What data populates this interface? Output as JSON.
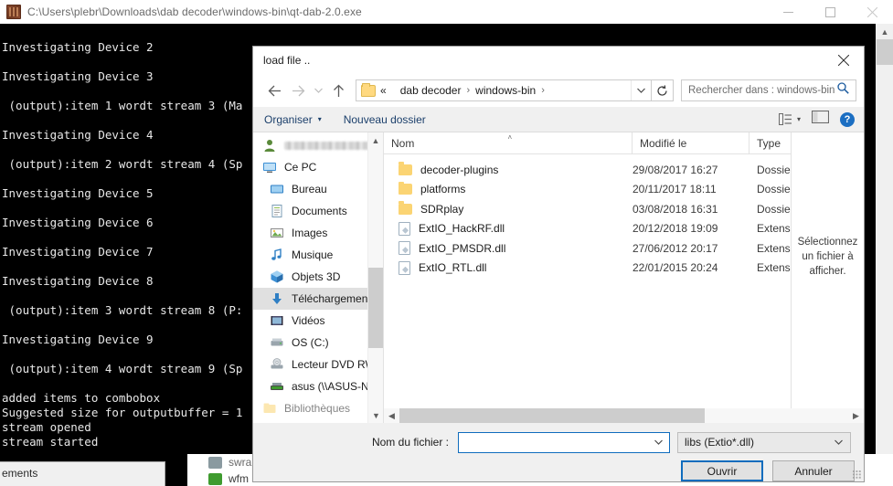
{
  "console_window": {
    "title": "C:\\Users\\plebr\\Downloads\\dab decoder\\windows-bin\\qt-dab-2.0.exe",
    "app_icon": "app-icon",
    "controls": {
      "minimize": "minimize-icon",
      "maximize": "maximize-icon",
      "close": "close-icon"
    },
    "lines": [
      "Investigating Device 2",
      "Investigating Device 3",
      " (output):item 1 wordt stream 3 (Ma",
      "Investigating Device 4",
      " (output):item 2 wordt stream 4 (Sp",
      "Investigating Device 5",
      "Investigating Device 6",
      "Investigating Device 7",
      "Investigating Device 8",
      " (output):item 3 wordt stream 8 (P:",
      "Investigating Device 9",
      " (output):item 4 wordt stream 9 (Sp"
    ],
    "tail_lines": [
      "added items to combobox",
      "Suggested size for outputbuffer = 1",
      "stream opened",
      "stream started"
    ]
  },
  "background": {
    "left_window_label": "ements",
    "items": [
      {
        "label": "swra",
        "color": "#8a9aa0"
      },
      {
        "label": "wfm",
        "color": "#3f9b2f"
      }
    ]
  },
  "dialog": {
    "title": "load file ..",
    "close_icon": "close-icon",
    "nav": {
      "back_icon": "arrow-left-icon",
      "forward_icon": "arrow-right-icon",
      "history_icon": "chevron-down-icon",
      "up_icon": "arrow-up-icon",
      "folder_icon": "folder-icon",
      "breadcrumb_prefix": "«",
      "breadcrumbs": [
        "dab decoder",
        "windows-bin"
      ],
      "breadcrumb_sep": "›",
      "dropdown_icon": "chevron-down-icon",
      "refresh_icon": "refresh-icon"
    },
    "search": {
      "placeholder": "Rechercher dans : windows-bin",
      "icon": "search-icon"
    },
    "toolbar": {
      "organize_label": "Organiser",
      "organize_caret": "▾",
      "new_folder_label": "Nouveau dossier",
      "view_icon": "view-list-icon",
      "view_caret": "▾",
      "preview_pane_icon": "preview-pane-icon",
      "help_icon": "help-icon",
      "help_glyph": "?"
    },
    "sidebar": {
      "items": [
        {
          "label": "",
          "icon": "user-icon",
          "blurred": true,
          "selected": false,
          "level": 0
        },
        {
          "label": "Ce PC",
          "icon": "computer-icon",
          "selected": false,
          "level": 0
        },
        {
          "label": "Bureau",
          "icon": "desktop-icon",
          "selected": false,
          "level": 1
        },
        {
          "label": "Documents",
          "icon": "documents-icon",
          "selected": false,
          "level": 1
        },
        {
          "label": "Images",
          "icon": "pictures-icon",
          "selected": false,
          "level": 1
        },
        {
          "label": "Musique",
          "icon": "music-icon",
          "selected": false,
          "level": 1
        },
        {
          "label": "Objets 3D",
          "icon": "3d-objects-icon",
          "selected": false,
          "level": 1
        },
        {
          "label": "Téléchargemen",
          "icon": "downloads-icon",
          "selected": true,
          "level": 1
        },
        {
          "label": "Vidéos",
          "icon": "videos-icon",
          "selected": false,
          "level": 1
        },
        {
          "label": "OS (C:)",
          "icon": "drive-icon",
          "selected": false,
          "level": 1
        },
        {
          "label": "Lecteur DVD RW",
          "icon": "dvd-drive-icon",
          "selected": false,
          "level": 1
        },
        {
          "label": "asus (\\\\ASUS-N",
          "icon": "network-drive-icon",
          "selected": false,
          "level": 1
        },
        {
          "label": "Bibliothèques",
          "icon": "libraries-icon",
          "selected": false,
          "level": 0
        }
      ],
      "scroll_up_icon": "chevron-up-icon",
      "scroll_down_icon": "chevron-down-icon"
    },
    "filelist": {
      "columns": [
        "Nom",
        "Modifié le",
        "Type"
      ],
      "sort_caret": "˄",
      "rows": [
        {
          "name": "decoder-plugins",
          "modified": "29/08/2017 16:27",
          "type": "Dossier",
          "icon": "folder-icon"
        },
        {
          "name": "platforms",
          "modified": "20/11/2017 18:11",
          "type": "Dossier",
          "icon": "folder-icon"
        },
        {
          "name": "SDRplay",
          "modified": "03/08/2018 16:31",
          "type": "Dossier",
          "icon": "folder-icon"
        },
        {
          "name": "ExtIO_HackRF.dll",
          "modified": "20/12/2018 19:09",
          "type": "Extensi",
          "icon": "dll-file-icon"
        },
        {
          "name": "ExtIO_PMSDR.dll",
          "modified": "27/06/2012 20:17",
          "type": "Extensi",
          "icon": "dll-file-icon"
        },
        {
          "name": "ExtIO_RTL.dll",
          "modified": "22/01/2015 20:24",
          "type": "Extensi",
          "icon": "dll-file-icon"
        }
      ],
      "hscroll_left_icon": "chevron-left-icon",
      "hscroll_right_icon": "chevron-right-icon"
    },
    "preview": {
      "text": "Sélectionnez un fichier à afficher."
    },
    "footer": {
      "filename_label": "Nom du fichier :",
      "filename_value": "",
      "filename_caret": "⌄",
      "filter_value": "libs  (Extio*.dll)",
      "filter_caret": "⌄",
      "open_label": "Ouvrir",
      "cancel_label": "Annuler"
    }
  },
  "colors": {
    "accent_blue": "#0f6cbd",
    "console_bg": "#000000",
    "console_fg": "#e8e8e8",
    "dialog_bg": "#f0f0f0",
    "folder_yellow": "#fbd473"
  }
}
